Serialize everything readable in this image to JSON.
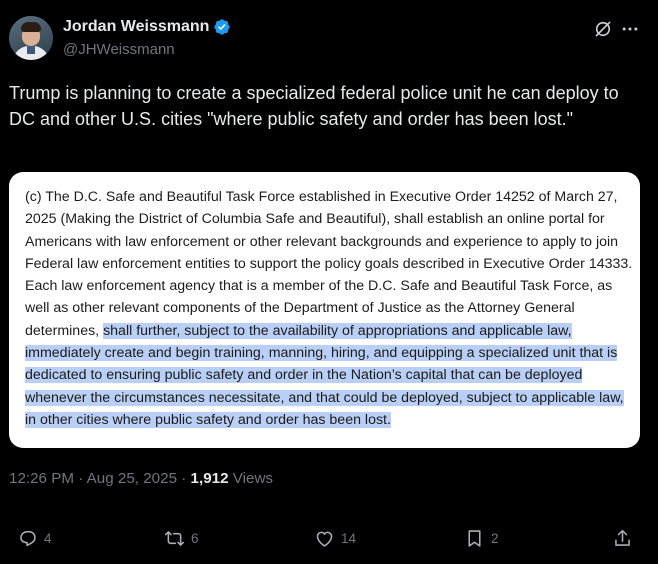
{
  "author": {
    "display_name": "Jordan Weissmann",
    "handle": "@JHWeissmann"
  },
  "tweet": {
    "text": "Trump is planning to create a specialized federal police unit he can deploy to DC and other U.S. cities \"where public safety and order has been lost.\""
  },
  "image_card": {
    "plain_text": "(c)  The D.C. Safe and Beautiful Task Force established in Executive Order 14252 of March 27, 2025 (Making the District of Columbia Safe and Beautiful), shall establish an online portal for Americans with law enforcement or other relevant backgrounds and experience to apply to join Federal law enforcement entities to support the policy goals described in Executive Order 14333.  Each law enforcement agency that is a member of the D.C. Safe and Beautiful Task Force, as well as other relevant components of the Department of Justice as the Attorney General determines, ",
    "highlighted_text": "shall further, subject to the availability of appropriations and applicable law, immediately create and begin training, manning, hiring, and equipping a specialized unit that is dedicated to ensuring public safety and order in the Nation’s capital that can be deployed whenever the circumstances necessitate, and that could be deployed, subject to applicable law, in other cities where public safety and order has been lost.",
    "highlight_color": "#b9cff5"
  },
  "meta": {
    "timestamp": "12:26 PM · Aug 25, 2025 · ",
    "views_count": "1,912",
    "views_label": " Views"
  },
  "actions": {
    "reply_count": "4",
    "retweet_count": "6",
    "like_count": "14",
    "bookmark_count": "2"
  },
  "icons": {
    "verified": "verified-badge-icon",
    "grok": "grok-icon",
    "more": "more-dots-icon",
    "reply": "reply-icon",
    "retweet": "retweet-icon",
    "like": "heart-icon",
    "bookmark": "bookmark-icon",
    "share": "share-icon"
  },
  "colors": {
    "background": "#000000",
    "text": "#e7e9ea",
    "secondary": "#71767b",
    "verified": "#1d9bf0"
  }
}
